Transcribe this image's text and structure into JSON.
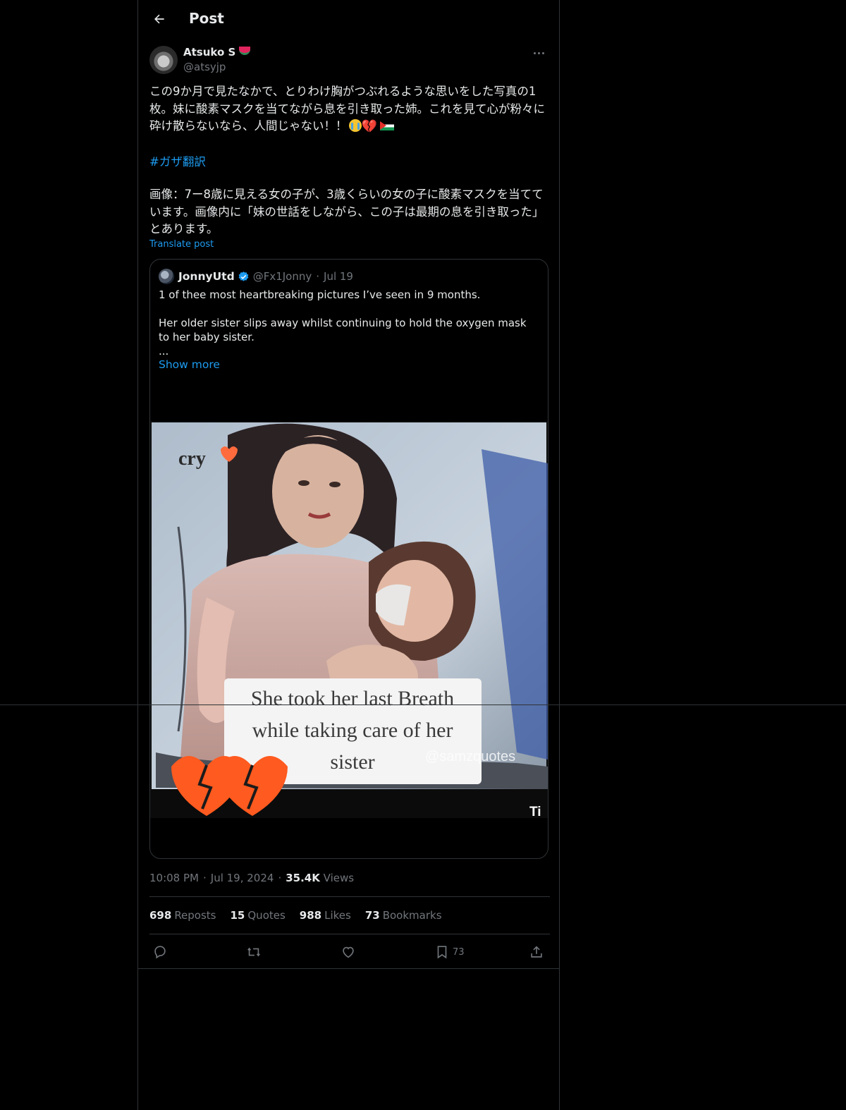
{
  "header": {
    "title": "Post"
  },
  "author": {
    "name": "Atsuko S",
    "handle": "@atsyjp"
  },
  "post": {
    "text": "この9か月で見たなかで、とりわけ胸がつぶれるような思いをした写真の1枚。妹に酸素マスクを当てながら息を引き取った姉。これを見て心が粉々に砕け散らないなら、人間じゃない！！",
    "hashtag": "#ガザ翻訳",
    "description": "画像：7ー8歳に見える女の子が、3歳くらいの女の子に酸素マスクを当てています。画像内に「妹の世話をしながら、この子は最期の息を引き取った」とあります。",
    "translate_label": "Translate post"
  },
  "quote": {
    "name": "JonnyUtd",
    "handle": "@Fx1Jonny",
    "dot": "·",
    "date": "Jul 19",
    "line1": "1 of thee most heartbreaking pictures I’ve seen in 9 months.",
    "line2": "Her older sister slips away whilst continuing to hold the oxygen mask to her baby sister.",
    "ellipsis": "...",
    "show_more": "Show more",
    "image": {
      "caption_line1": "She took her last Breath",
      "caption_line2": "while taking care of her",
      "caption_line3": "sister",
      "sticker_text": "cry",
      "watermark_handle": "@samzquotes",
      "watermark_tiktok": "Ti"
    }
  },
  "meta": {
    "time": "10:08 PM",
    "dot": "·",
    "date": "Jul 19, 2024",
    "views_count": "35.4K",
    "views_label": "Views"
  },
  "stats": {
    "reposts_count": "698",
    "reposts_label": "Reposts",
    "quotes_count": "15",
    "quotes_label": "Quotes",
    "likes_count": "988",
    "likes_label": "Likes",
    "bookmarks_count": "73",
    "bookmarks_label": "Bookmarks"
  },
  "actions": {
    "bookmark_count": "73"
  },
  "icons": {
    "back": "arrow-left-icon",
    "more": "more-horizontal-icon",
    "verified": "verified-badge-icon",
    "reply": "reply-icon",
    "repost": "repost-icon",
    "like": "heart-icon",
    "bookmark": "bookmark-icon",
    "share": "share-icon"
  },
  "colors": {
    "background": "#000000",
    "text": "#e7e9ea",
    "secondary": "#71767b",
    "link": "#1d9bf0",
    "border": "#2f3336"
  }
}
